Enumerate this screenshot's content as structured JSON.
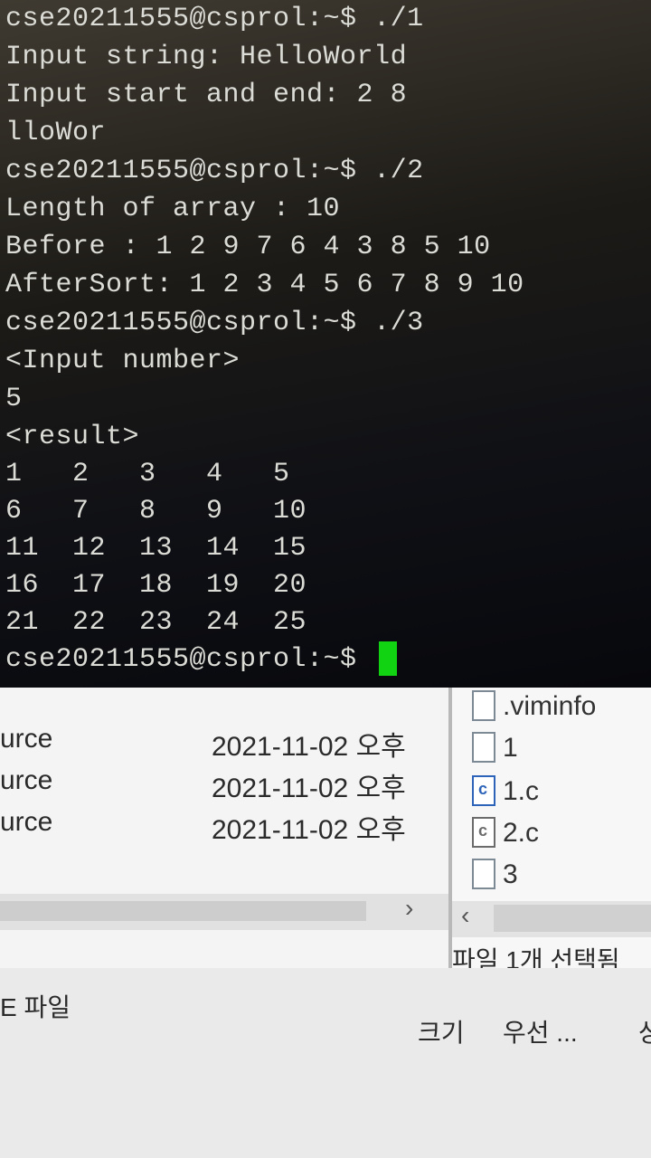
{
  "terminal": {
    "lines": [
      "cse20211555@csprol:~$ ./1",
      "Input string: HelloWorld",
      "Input start and end: 2 8",
      "lloWor",
      "cse20211555@csprol:~$ ./2",
      "Length of array : 10",
      "Before : 1 2 9 7 6 4 3 8 5 10",
      "AfterSort: 1 2 3 4 5 6 7 8 9 10",
      "cse20211555@csprol:~$ ./3",
      "<Input number>",
      "5",
      "<result>",
      "1   2   3   4   5",
      "6   7   8   9   10",
      "11  12  13  14  15",
      "16  17  18  19  20",
      "21  22  23  24  25"
    ],
    "prompt": "cse20211555@csprol:~$ ",
    "cursor_color": "#12d312"
  },
  "explorer": {
    "rows": [
      {
        "type": "urce",
        "date": "2021-11-02 오후"
      },
      {
        "type": "urce",
        "date": "2021-11-02 오후"
      },
      {
        "type": "urce",
        "date": "2021-11-02 오후"
      }
    ],
    "files": [
      {
        "name": ".viminfo",
        "icon": "file-icon"
      },
      {
        "name": "1",
        "icon": "file-icon"
      },
      {
        "name": "1.c",
        "icon": "c-source-file-icon"
      },
      {
        "name": "2.c",
        "icon": "c-source-file-icon"
      },
      {
        "name": "3",
        "icon": "file-icon"
      }
    ],
    "scroll_right_arrow": "›",
    "scroll_left_arrow": "‹",
    "status": "파일 1개 선택됨",
    "bottom_label": "E 파일",
    "buttons": {
      "size": "크기",
      "priority": "우선 ...",
      "more": "상"
    }
  }
}
